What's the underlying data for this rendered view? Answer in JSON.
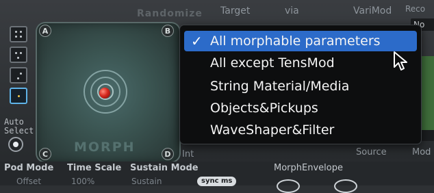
{
  "header": {
    "randomize_label": "Randomize",
    "target_label": "Target",
    "via_label": "via",
    "varimod_label": "VariMod",
    "record_fragment": "Reco",
    "no_fragment": "No",
    "source_label": "Source",
    "mod_label": "Mod",
    "int_label": "Int"
  },
  "pad": {
    "corners": [
      "A",
      "B",
      "C",
      "D"
    ],
    "label": "MORPH",
    "auto_select_label": "Auto\nSelect"
  },
  "morph_menu": {
    "items": [
      {
        "label": "All morphable parameters",
        "selected": true
      },
      {
        "label": "All except TensMod",
        "selected": false
      },
      {
        "label": "String Material/Media",
        "selected": false
      },
      {
        "label": "Objects&Pickups",
        "selected": false
      },
      {
        "label": "WaveShaper&Filter",
        "selected": false
      }
    ],
    "check_glyph": "✓"
  },
  "bottom": {
    "pod_mode": "Pod Mode",
    "time_scale": "Time Scale",
    "sustain_mode": "Sustain Mode",
    "morph_envelope": "MorphEnvelope",
    "offset": "Offset",
    "percent": "100%",
    "sustain": "Sustain",
    "sync_ms": "sync ms"
  },
  "colors": {
    "menu_highlight": "#2c6bc9",
    "active_mode": "#5fb3e8",
    "morph_point": "#d6281e"
  }
}
